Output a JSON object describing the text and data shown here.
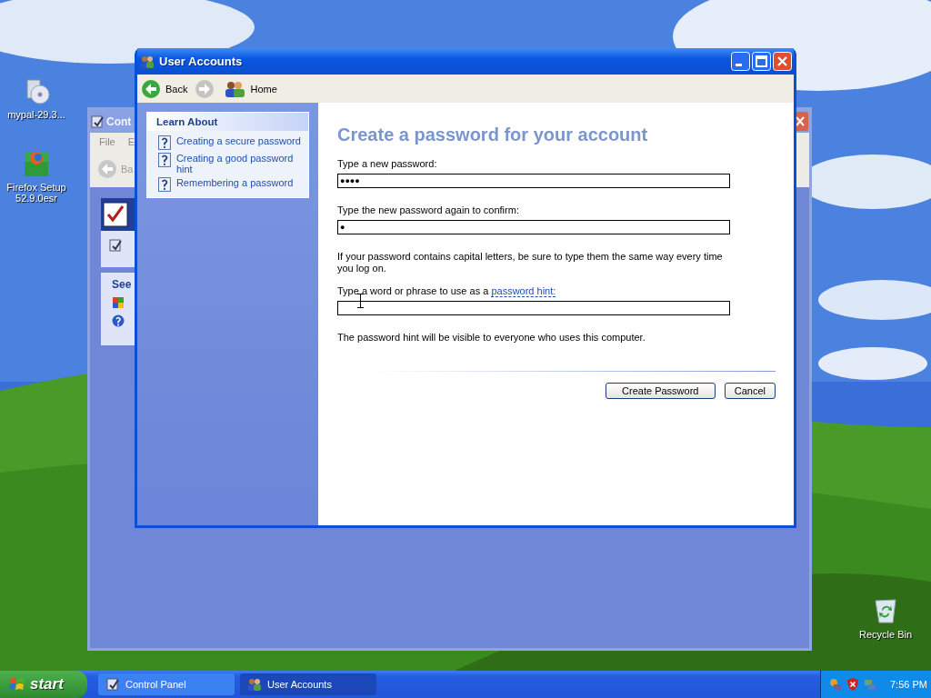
{
  "desktop_icons": [
    {
      "kind": "disc",
      "label": "mypal-29.3..."
    },
    {
      "kind": "installer",
      "label": "Firefox Setup 52.9.0esr"
    },
    {
      "kind": "bin",
      "label": "Recycle Bin"
    }
  ],
  "background_window": {
    "title": "Cont",
    "menu": [
      "File",
      "E"
    ],
    "back": "Ba",
    "panel_title": "See"
  },
  "window": {
    "title": "User Accounts",
    "back": "Back",
    "home": "Home",
    "learn_about": {
      "title": "Learn About",
      "items": [
        "Creating a secure password",
        "Creating a good password hint",
        "Remembering a password"
      ]
    },
    "heading": "Create a password for your account",
    "fields": [
      {
        "label": "Type a new password:",
        "value": "●●●●"
      },
      {
        "label": "Type the new password again to confirm:",
        "value": "●"
      }
    ],
    "note": "If your password contains capital letters, be sure to type them the same way every time you log on.",
    "hint_label": "Type a word or phrase to use as a",
    "hint_link": "password hint:",
    "footer_note": "The password hint will be visible to everyone who uses this computer.",
    "buttons": [
      "Create Password",
      "Cancel"
    ]
  },
  "taskbar": {
    "start": "start",
    "tasks": [
      {
        "label": "Control Panel",
        "selected": false
      },
      {
        "label": "User Accounts",
        "selected": true
      }
    ],
    "clock": "7:56 PM"
  }
}
